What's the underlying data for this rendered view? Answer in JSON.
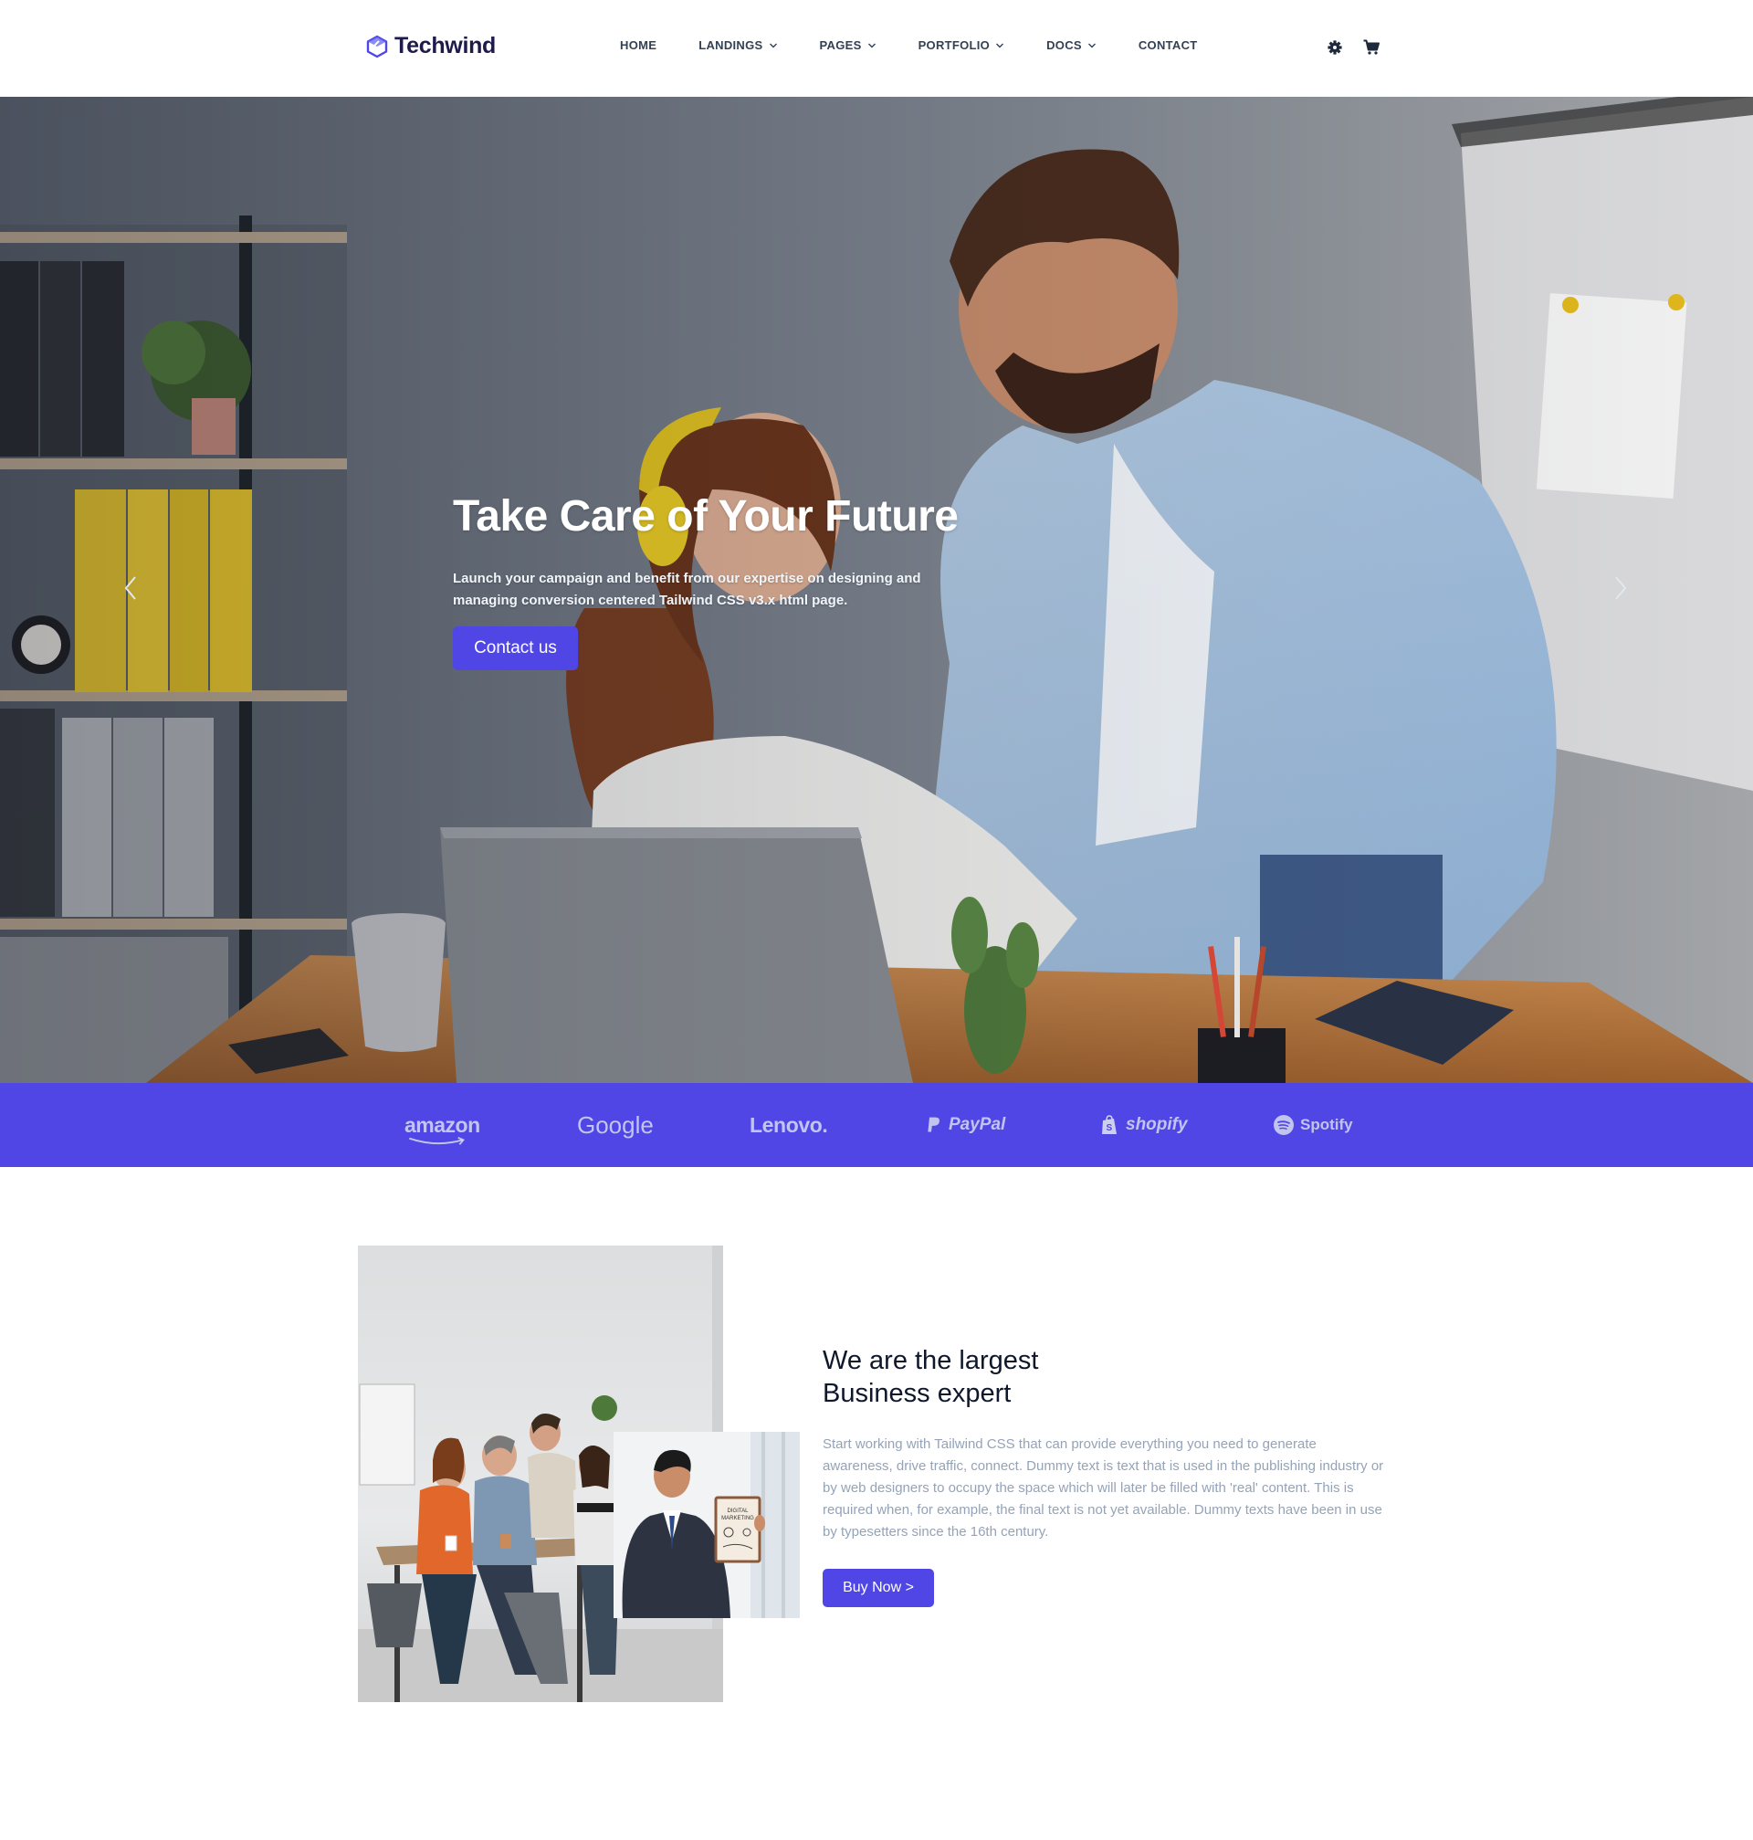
{
  "brand": {
    "name": "Techwind",
    "accent_color": "#4f46e5",
    "logo_icon": "cube-logo-icon"
  },
  "nav": {
    "items": [
      {
        "label": "HOME",
        "has_dropdown": false
      },
      {
        "label": "LANDINGS",
        "has_dropdown": true
      },
      {
        "label": "PAGES",
        "has_dropdown": true
      },
      {
        "label": "PORTFOLIO",
        "has_dropdown": true
      },
      {
        "label": "DOCS",
        "has_dropdown": true
      },
      {
        "label": "CONTACT",
        "has_dropdown": false
      }
    ],
    "icons": [
      "gear-icon",
      "cart-icon"
    ]
  },
  "hero": {
    "title": "Take Care of Your Future",
    "subtitle": "Launch your campaign and benefit from our expertise on designing and managing conversion centered Tailwind CSS v3.x html page.",
    "button_label": "Contact us",
    "prev_icon": "chevron-left-icon",
    "next_icon": "chevron-right-icon"
  },
  "brands": {
    "background": "#4f46e5",
    "items": [
      {
        "name": "amazon",
        "icon": "amazon-smile-icon"
      },
      {
        "name": "Google",
        "icon": ""
      },
      {
        "name": "Lenovo.",
        "icon": ""
      },
      {
        "name": "PayPal",
        "icon": "paypal-icon"
      },
      {
        "name": "shopify",
        "icon": "shopify-bag-icon"
      },
      {
        "name": "Spotify",
        "icon": "spotify-icon"
      }
    ]
  },
  "about": {
    "title_line1": "We are the largest",
    "title_line2": "Business expert",
    "text": "Start working with Tailwind CSS that can provide everything you need to generate awareness, drive traffic, connect. Dummy text is text that is used in the publishing industry or by web designers to occupy the space which will later be filled with 'real' content. This is required when, for example, the final text is not yet available. Dummy texts have been in use by typesetters since the 16th century.",
    "button_label": "Buy Now >"
  }
}
